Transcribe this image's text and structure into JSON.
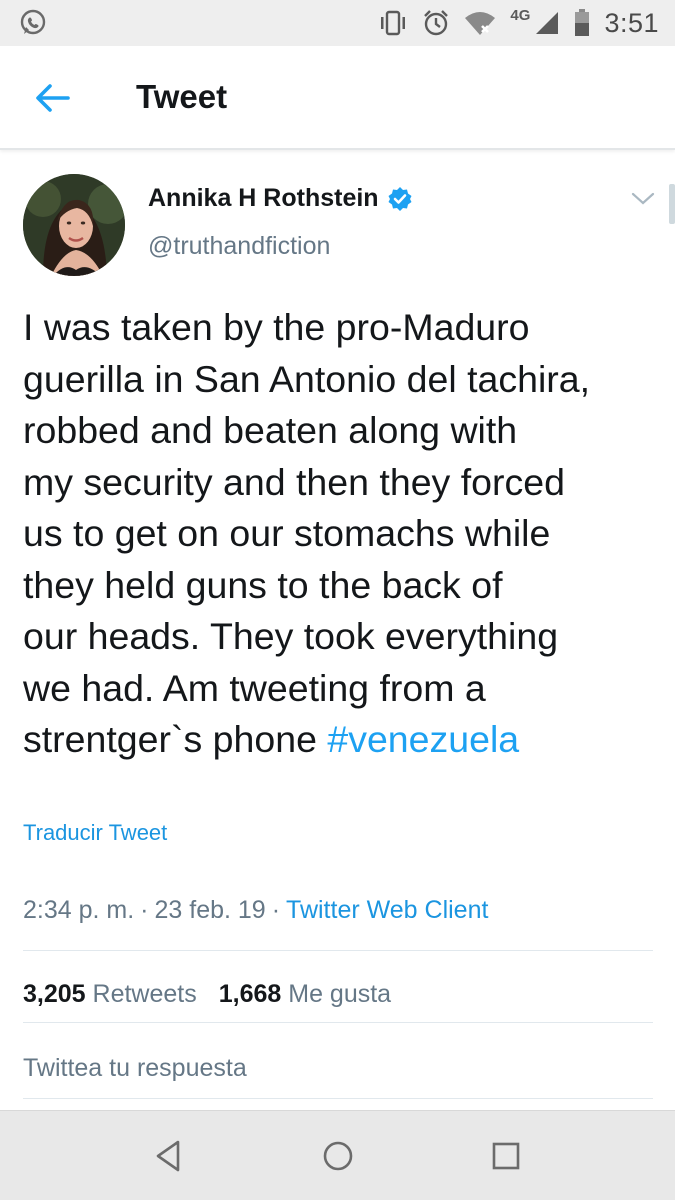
{
  "status_bar": {
    "network": "4G",
    "time": "3:51",
    "icons": [
      "whatsapp-icon",
      "vibrate-icon",
      "alarm-icon",
      "wifi-icon",
      "signal-icon",
      "battery-icon"
    ]
  },
  "app_bar": {
    "title": "Tweet",
    "back_icon": "arrow-left-icon"
  },
  "tweet": {
    "author_name": "Annika H Rothstein",
    "handle": "@truthandfiction",
    "verified": true,
    "text_lines": [
      "I was taken by the pro-Maduro",
      "guerilla in San Antonio del tachira,",
      "robbed and beaten along with",
      "my security and then they forced",
      "us to get on our stomachs while",
      "they held guns to the back of",
      "our heads. They took everything",
      "we had. Am tweeting from a",
      "strentger`s phone "
    ],
    "hashtag": "#venezuela",
    "translate_label": "Traducir Tweet",
    "time": "2:34 p. m.",
    "date": "23 feb. 19",
    "separator": "·",
    "client": "Twitter Web Client",
    "retweets_count": "3,205",
    "retweets_label": "Retweets",
    "likes_count": "1,668",
    "likes_label": "Me gusta",
    "reply_placeholder": "Twittea tu respuesta"
  },
  "colors": {
    "accent": "#1da1f2",
    "link": "#1b95e0",
    "text": "#14171a",
    "secondary": "#657786",
    "divider": "#e1e8ed"
  },
  "nav_bar": {
    "buttons": [
      "back-triangle-icon",
      "home-circle-icon",
      "recents-square-icon"
    ]
  }
}
